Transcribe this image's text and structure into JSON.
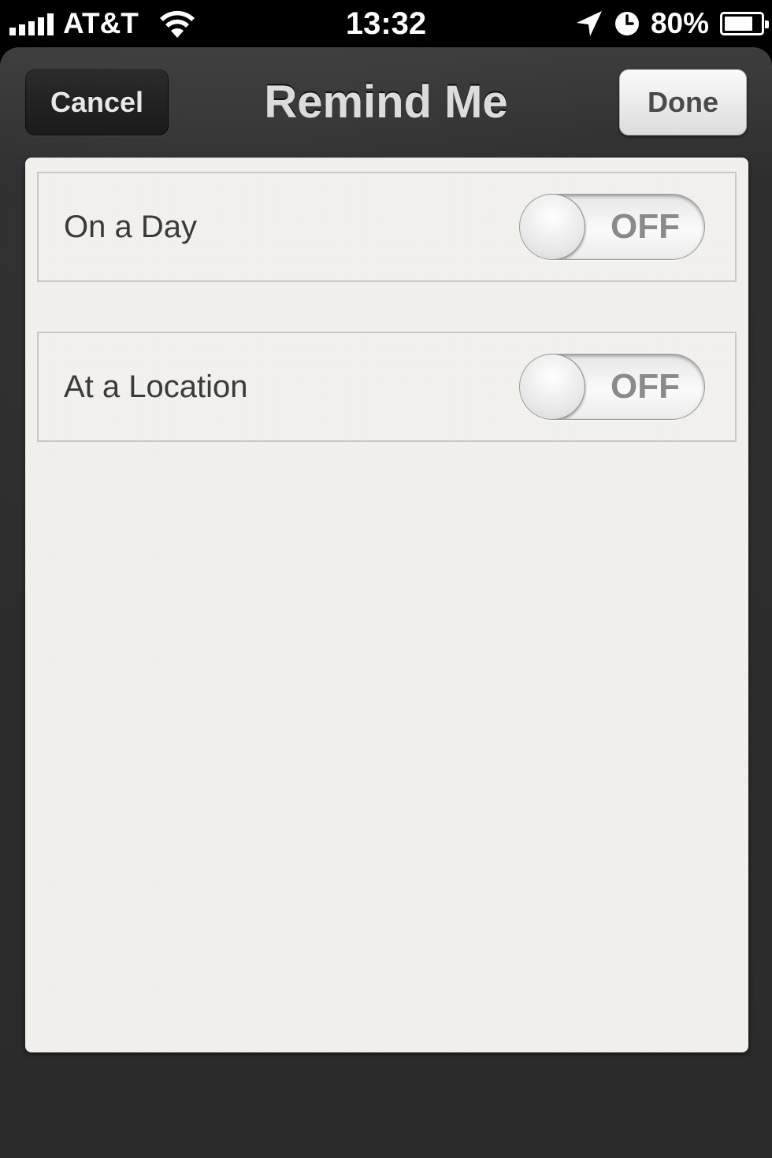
{
  "status_bar": {
    "carrier": "AT&T",
    "time": "13:32",
    "battery_percent": "80%",
    "battery_level": 0.8,
    "icons": [
      "signal-icon",
      "wifi-icon",
      "location-arrow-icon",
      "alarm-clock-icon",
      "battery-icon"
    ]
  },
  "nav": {
    "title": "Remind Me",
    "cancel_label": "Cancel",
    "done_label": "Done"
  },
  "options": [
    {
      "label": "On a Day",
      "toggle": "OFF",
      "on": false
    },
    {
      "label": "At a Location",
      "toggle": "OFF",
      "on": false
    }
  ],
  "colors": {
    "leather": "#2e2e2e",
    "paper": "#f1f0ec",
    "row_border": "#c9c8c4",
    "label_text": "#3a3a3a",
    "toggle_text": "#8a8a8a"
  }
}
